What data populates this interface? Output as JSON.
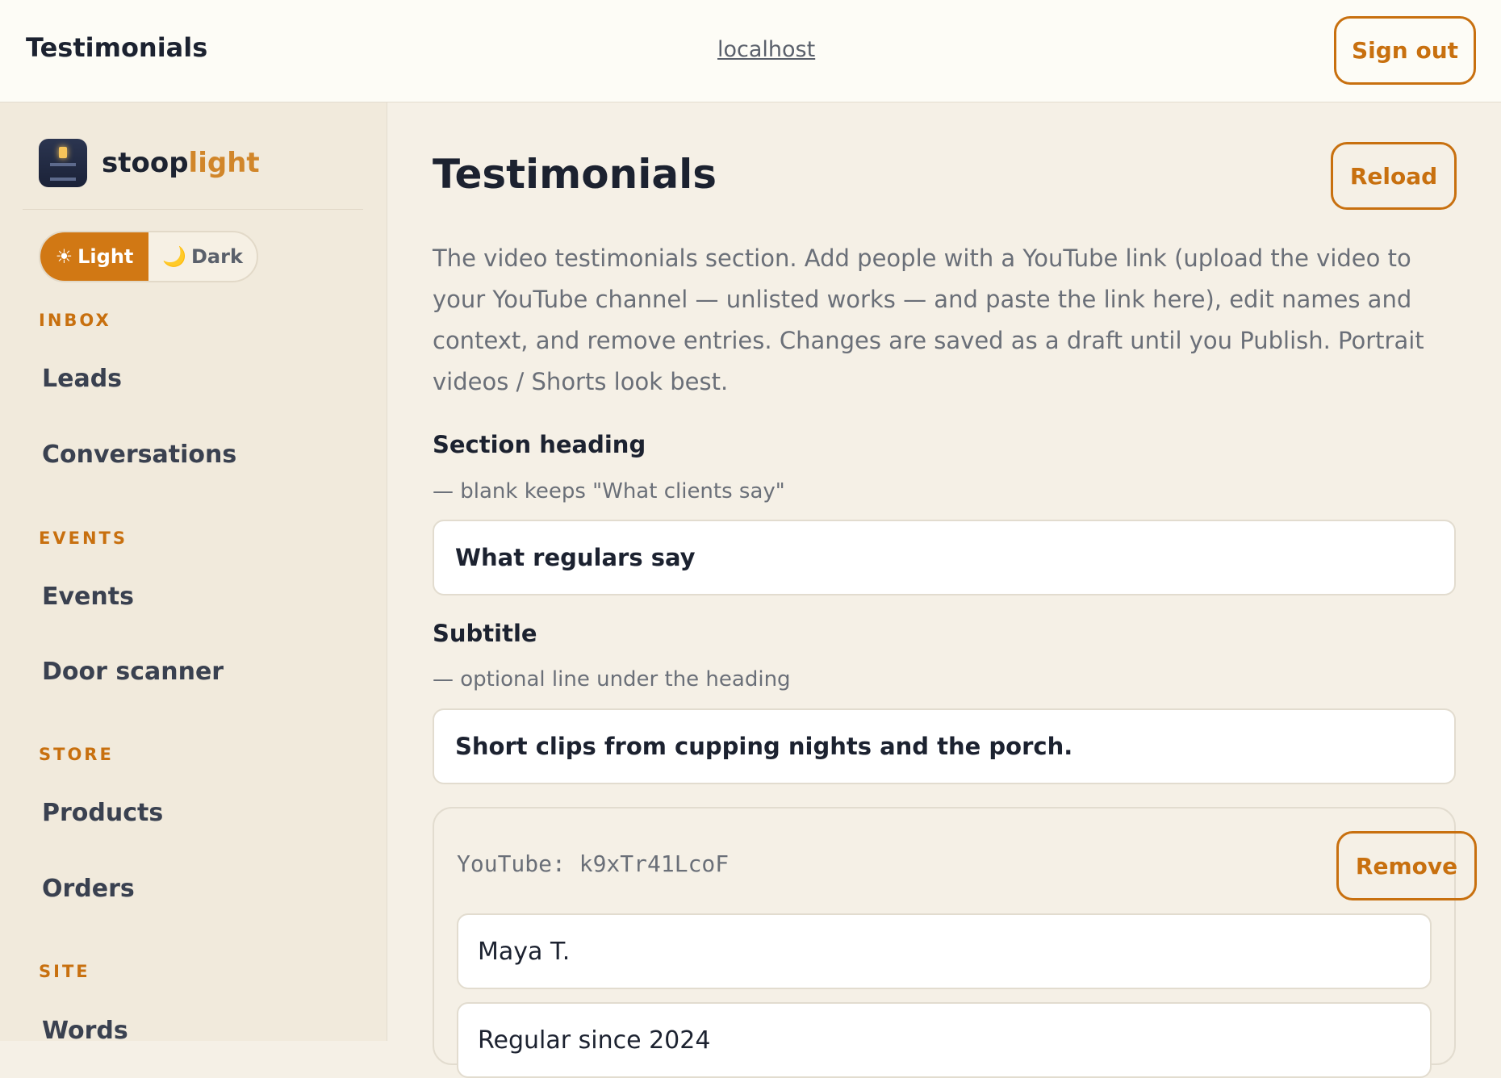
{
  "topbar": {
    "title": "Testimonials",
    "host": "localhost",
    "sign_out_label": "Sign out"
  },
  "sidebar": {
    "brand_part1": "stoop",
    "brand_part2": "light",
    "theme": {
      "light_icon": "☀",
      "light_label": "Light",
      "dark_icon": "🌙",
      "dark_label": "Dark",
      "active": "light"
    },
    "sections": [
      {
        "title": "INBOX",
        "items": [
          "Leads",
          "Conversations"
        ]
      },
      {
        "title": "EVENTS",
        "items": [
          "Events",
          "Door scanner"
        ]
      },
      {
        "title": "STORE",
        "items": [
          "Products",
          "Orders"
        ]
      },
      {
        "title": "SITE",
        "items": [
          "Words"
        ]
      }
    ]
  },
  "main": {
    "title": "Testimonials",
    "reload_label": "Reload",
    "description": "The video testimonials section. Add people with a YouTube link (upload the video to your YouTube channel — unlisted works — and paste the link here), edit names and context, and remove entries. Changes are saved as a draft until you Publish. Portrait videos / Shorts look best.",
    "section_heading": {
      "label": "Section heading",
      "hint": "— blank keeps \"What clients say\"",
      "value": "What regulars say"
    },
    "subtitle": {
      "label": "Subtitle",
      "hint": "— optional line under the heading",
      "value": "Short clips from cupping nights and the porch."
    },
    "testimonials": [
      {
        "youtube_label": "YouTube: k9xTr41LcoF",
        "remove_label": "Remove",
        "name": "Maya T.",
        "context": "Regular since 2024"
      }
    ]
  },
  "colors": {
    "accent": "#c8700f",
    "background": "#f5f0e6",
    "sidebar": "#f1eadc"
  }
}
